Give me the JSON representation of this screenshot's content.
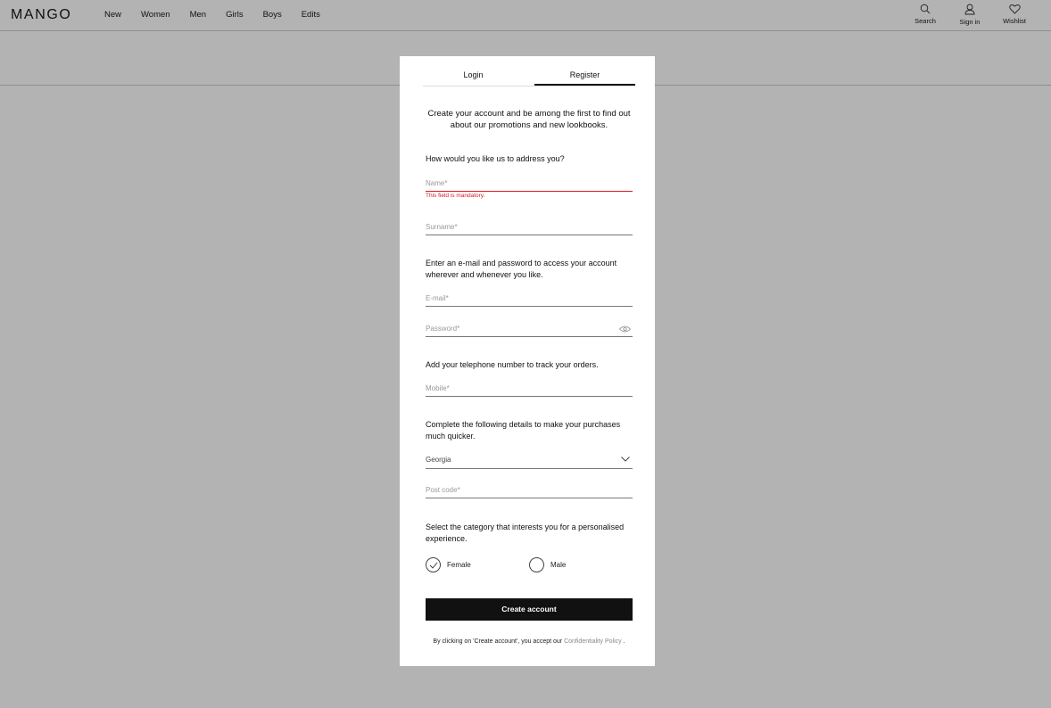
{
  "header": {
    "logo": "MANGO",
    "nav": [
      "New",
      "Women",
      "Men",
      "Girls",
      "Boys",
      "Edits"
    ],
    "actions": [
      {
        "label": "Search",
        "icon": "search-icon"
      },
      {
        "label": "Sign in",
        "icon": "user-icon"
      },
      {
        "label": "Wishlist",
        "icon": "heart-icon"
      }
    ]
  },
  "modal": {
    "tabs": {
      "login": "Login",
      "register": "Register",
      "active": "register"
    },
    "intro": "Create your account and be among the first to find out about our promotions and new lookbooks.",
    "address_prompt": "How would you like us to address you?",
    "name_placeholder": "Name*",
    "name_error": "This field is mandatory.",
    "surname_placeholder": "Surname*",
    "credentials_prompt": "Enter an e-mail and password to access your account wherever and whenever you like.",
    "email_placeholder": "E-mail*",
    "password_placeholder": "Password*",
    "phone_prompt": "Add your telephone number to track your orders.",
    "mobile_placeholder": "Mobile*",
    "details_prompt": "Complete the following details to make your purchases much quicker.",
    "country_value": "Georgia",
    "postcode_placeholder": "Post code*",
    "category_prompt": "Select the category that interests you for a personalised experience.",
    "category_options": [
      {
        "label": "Female",
        "selected": true
      },
      {
        "label": "Male",
        "selected": false
      }
    ],
    "submit_label": "Create account",
    "legal_prefix": "By clicking on 'Create account', you accept our",
    "legal_link": "Confidentiality Policy",
    "legal_suffix": "."
  },
  "colors": {
    "overlay_bg": "#b3b3b3",
    "error": "#d8191f",
    "button_bg": "#111111"
  }
}
